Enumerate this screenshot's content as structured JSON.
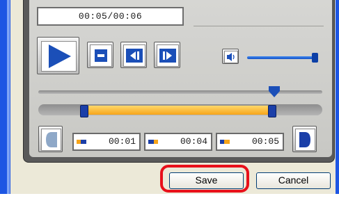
{
  "player": {
    "time_display": "00:05/00:06",
    "volume_level": 0.95,
    "playhead_fraction": 0.83,
    "range_start_fraction": 0.16,
    "range_end_fraction": 0.82
  },
  "timecodes": {
    "start": "00:01",
    "end": "00:04",
    "current": "00:05"
  },
  "buttons": {
    "save": "Save",
    "cancel": "Cancel"
  },
  "icons": {
    "play": "play-icon",
    "stop": "stop-icon",
    "step_back": "step-back-icon",
    "step_forward": "step-forward-icon",
    "volume": "speaker-icon",
    "mark_in": "mark-in-icon",
    "mark_out": "mark-out-icon"
  },
  "colors": {
    "accent_blue": "#1b4fb8",
    "range_fill": "#f6a51a",
    "save_highlight": "#e8101a"
  }
}
